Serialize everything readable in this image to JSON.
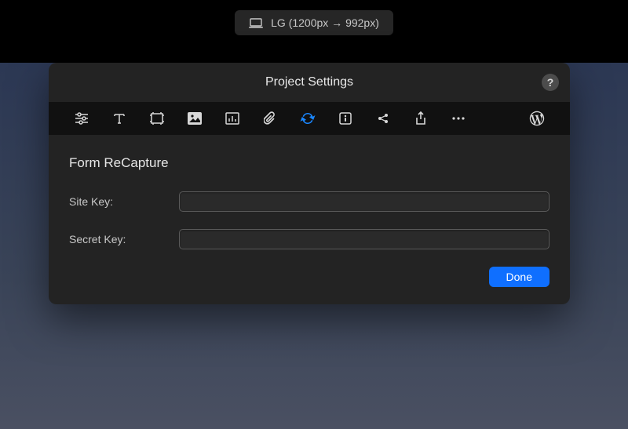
{
  "topbar": {
    "breakpoint_label": "LG (1200px → 992px)"
  },
  "panel": {
    "title": "Project Settings",
    "section_title": "Form ReCapture",
    "site_key_label": "Site Key:",
    "secret_key_label": "Secret Key:",
    "site_key_value": "",
    "secret_key_value": "",
    "done_label": "Done",
    "help_label": "?"
  },
  "tabs": {
    "icons": [
      "sliders-icon",
      "type-icon",
      "artboard-icon",
      "image-icon",
      "chart-icon",
      "paperclip-icon",
      "refresh-icon",
      "info-icon",
      "share-icon",
      "export-icon",
      "more-icon",
      "wordpress-icon"
    ],
    "active_index": 6
  },
  "colors": {
    "accent": "#0f6fff",
    "active_icon": "#1a87ff",
    "panel_bg": "#232323",
    "tabbar_bg": "#111111"
  }
}
